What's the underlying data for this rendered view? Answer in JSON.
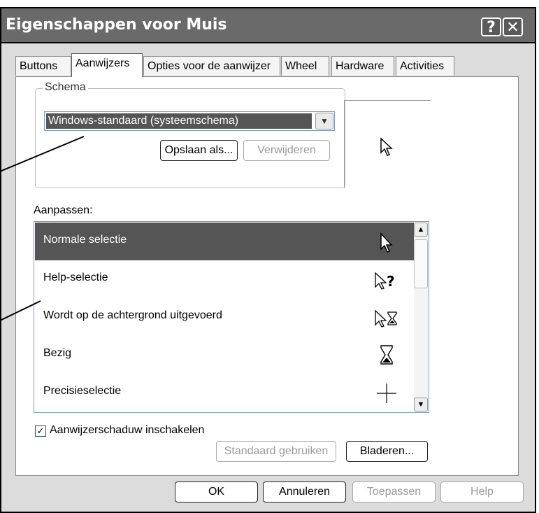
{
  "window": {
    "title": "Eigenschappen voor Muis",
    "help_glyph": "?",
    "close_glyph": "✕"
  },
  "tabs": [
    {
      "label": "Buttons"
    },
    {
      "label": "Aanwijzers"
    },
    {
      "label": "Opties voor de aanwijzer"
    },
    {
      "label": "Wheel"
    },
    {
      "label": "Hardware"
    },
    {
      "label": "Activities"
    }
  ],
  "active_tab": "Aanwijzers",
  "schema": {
    "legend": "Schema",
    "selected": "Windows-standaard (systeemschema)",
    "save_as": "Opslaan als...",
    "delete": "Verwijderen"
  },
  "customize": {
    "label": "Aanpassen:",
    "items": [
      {
        "label": "Normale selectie",
        "icon": "arrow-pointer-icon"
      },
      {
        "label": "Help-selectie",
        "icon": "help-select-icon"
      },
      {
        "label": "Wordt op de achtergrond uitgevoerd",
        "icon": "working-in-background-icon"
      },
      {
        "label": "Bezig",
        "icon": "hourglass-icon"
      },
      {
        "label": "Precisieselectie",
        "icon": "crosshair-icon"
      }
    ],
    "selected_index": 0
  },
  "shadow": {
    "label": "Aanwijzerschaduw inschakelen",
    "checked": true
  },
  "buttons": {
    "use_default": "Standaard gebruiken",
    "browse": "Bladeren...",
    "ok": "OK",
    "cancel": "Annuleren",
    "apply": "Toepassen",
    "help": "Help"
  },
  "colors": {
    "selection": "#555555",
    "titlebar": "#6a6a6a"
  }
}
